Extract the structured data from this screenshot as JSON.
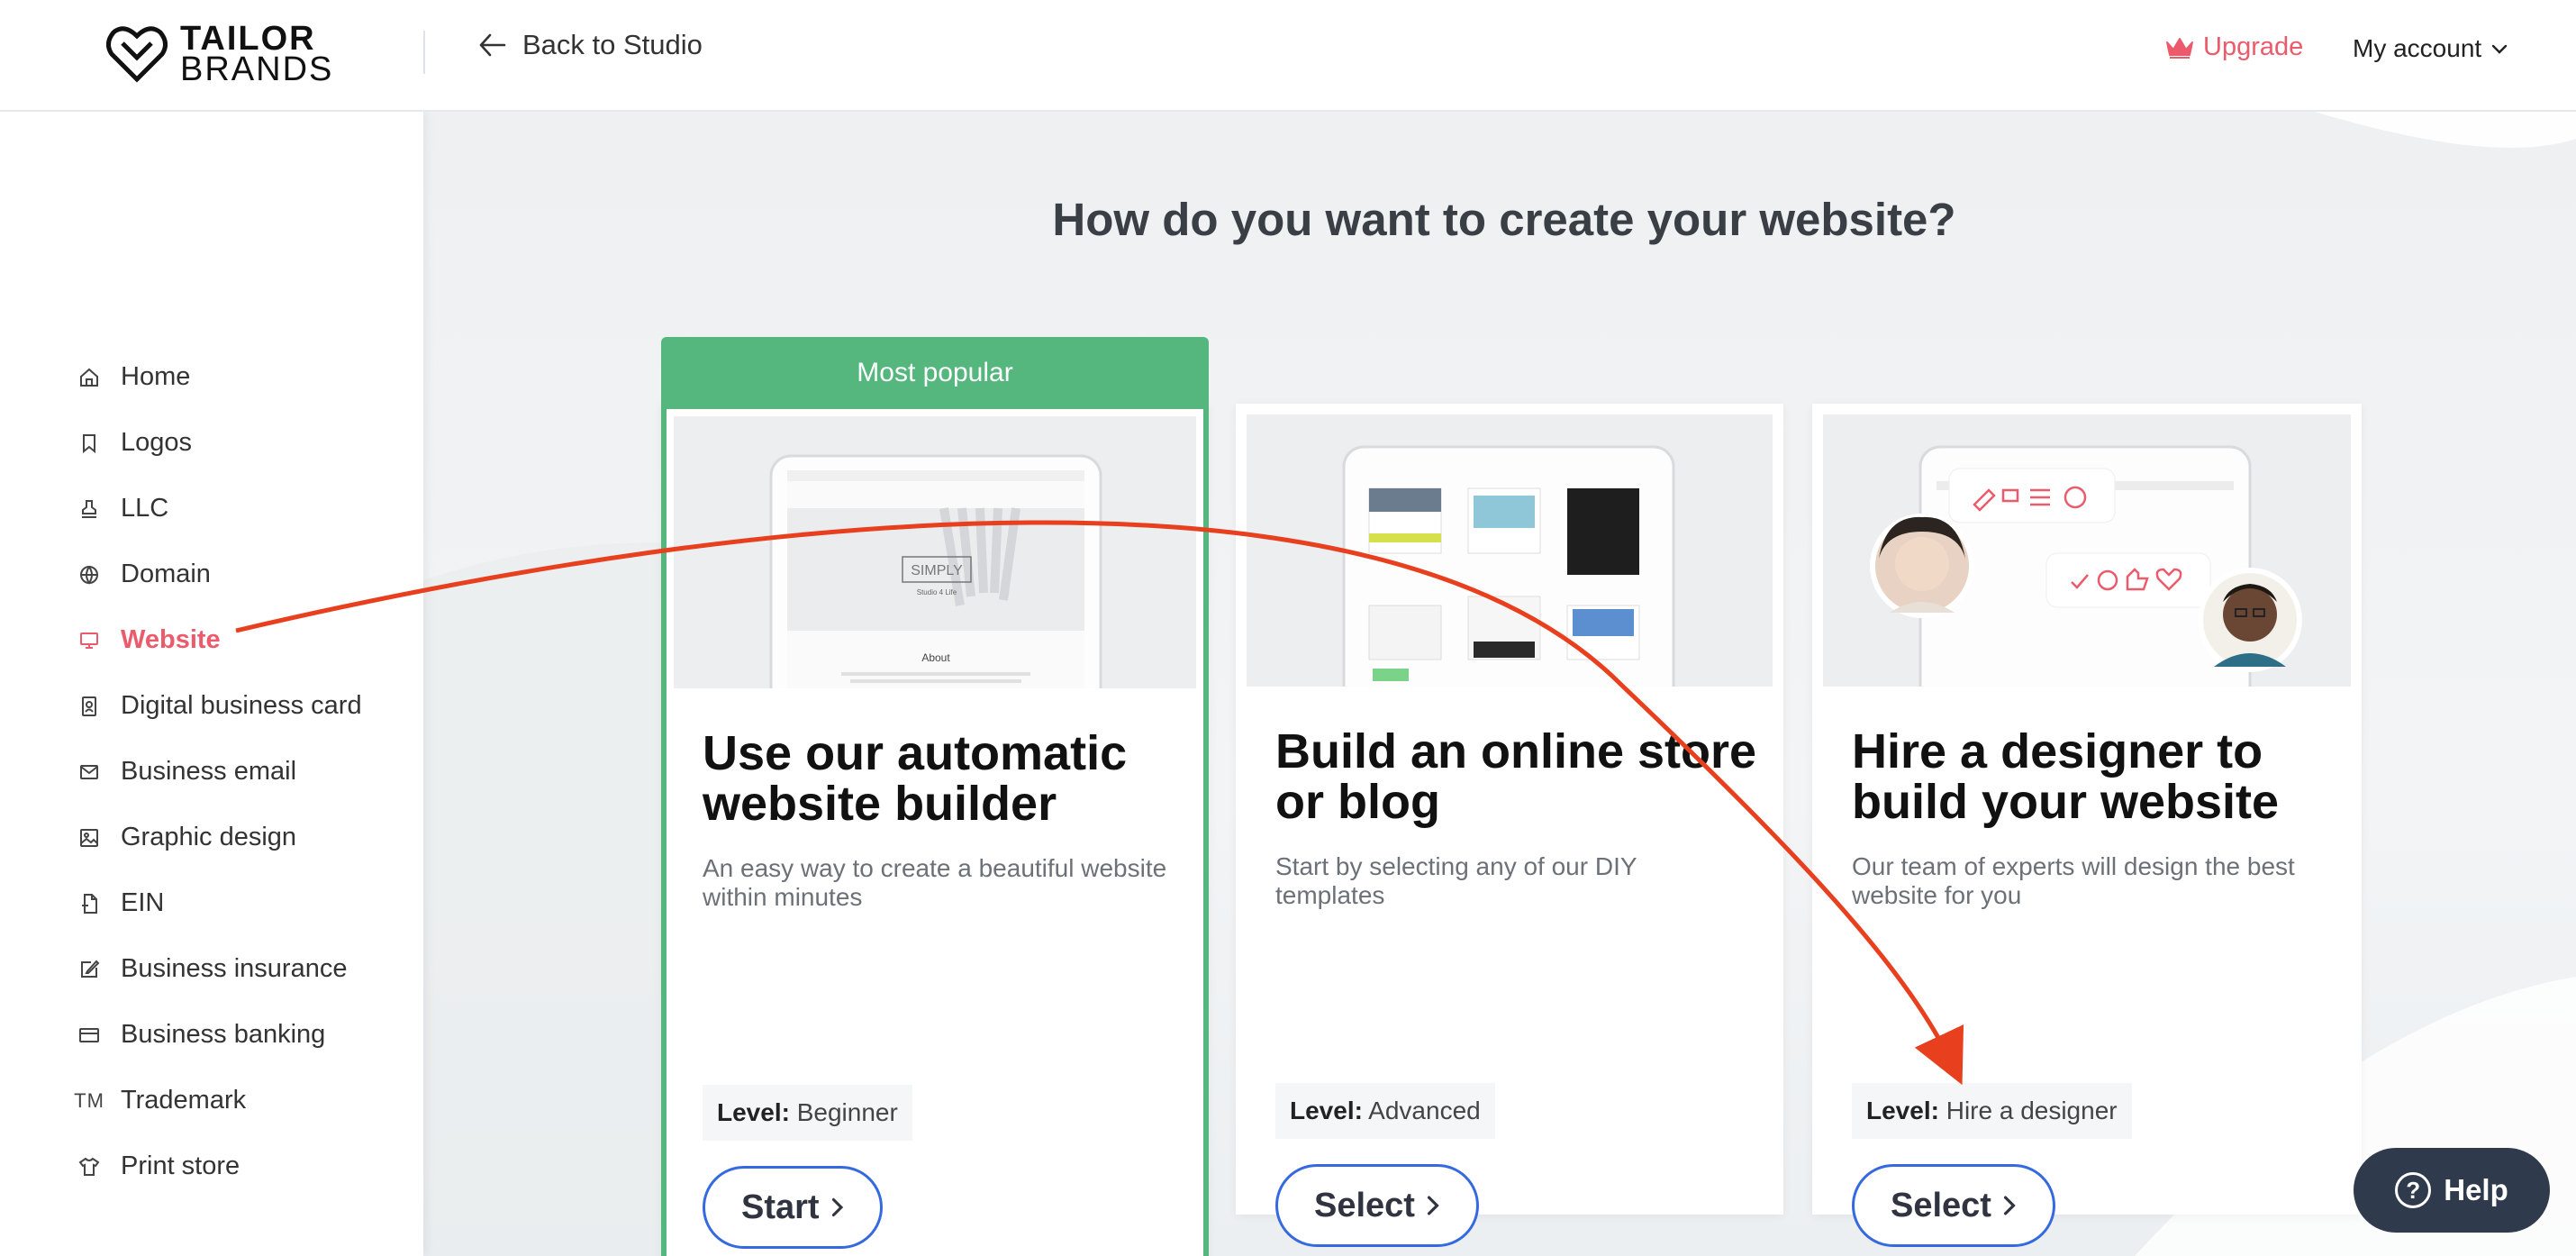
{
  "brand": {
    "line1": "TAILOR",
    "line2": "BRANDS"
  },
  "header": {
    "back_label": "Back to Studio",
    "upgrade_label": "Upgrade",
    "account_label": "My account"
  },
  "sidebar": {
    "items": [
      {
        "label": "Home",
        "icon": "home-icon"
      },
      {
        "label": "Logos",
        "icon": "bookmark-icon"
      },
      {
        "label": "LLC",
        "icon": "stamp-icon"
      },
      {
        "label": "Domain",
        "icon": "globe-icon"
      },
      {
        "label": "Website",
        "icon": "monitor-icon",
        "active": true
      },
      {
        "label": "Digital business card",
        "icon": "id-card-icon"
      },
      {
        "label": "Business email",
        "icon": "mail-icon"
      },
      {
        "label": "Graphic design",
        "icon": "image-icon"
      },
      {
        "label": "EIN",
        "icon": "document-icon"
      },
      {
        "label": "Business insurance",
        "icon": "edit-icon"
      },
      {
        "label": "Business banking",
        "icon": "credit-card-icon"
      },
      {
        "label": "Trademark",
        "icon": "tm-icon",
        "icon_text": "TM"
      },
      {
        "label": "Print store",
        "icon": "shirt-icon"
      }
    ]
  },
  "main": {
    "heading": "How do you want to create your website?",
    "cards": [
      {
        "badge": "Most popular",
        "title": "Use our automatic website builder",
        "description": "An easy way to create a beautiful website within minutes",
        "level_label": "Level:",
        "level_value": "Beginner",
        "cta": "Start"
      },
      {
        "title": "Build an online store or blog",
        "description": "Start by selecting any of our DIY templates",
        "level_label": "Level:",
        "level_value": "Advanced",
        "cta": "Select"
      },
      {
        "title": "Hire a designer to build your website",
        "description": "Our team of experts will design the best website for you",
        "level_label": "Level:",
        "level_value": "Hire a designer",
        "cta": "Select"
      }
    ],
    "mockup_text": {
      "logo": "SIMPLY",
      "tagline": "Studio 4 Life",
      "about": "About"
    }
  },
  "help": {
    "label": "Help"
  },
  "colors": {
    "accent": "#ec5b6b",
    "featured": "#55b77d",
    "cta_border": "#3469e0",
    "annotation": "#e8401e"
  }
}
